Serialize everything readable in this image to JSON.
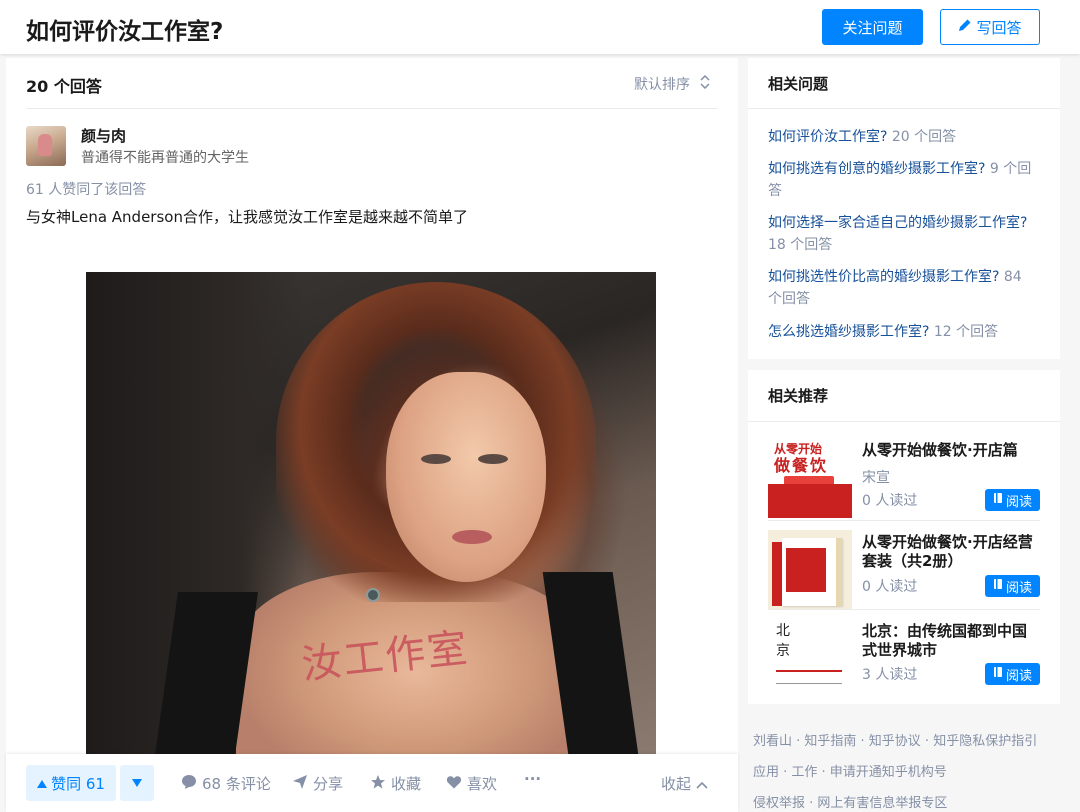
{
  "header": {
    "question_title": "如何评价汝工作室?",
    "follow_label": "关注问题",
    "write_label": "写回答"
  },
  "answers": {
    "count_label": "20 个回答",
    "sort_label": "默认排序"
  },
  "answer": {
    "author_name": "颜与肉",
    "author_bio": "普通得不能再普通的大学生",
    "upvote_text": "61 人赞同了该回答",
    "content": "与女神Lena Anderson合作，让我感觉汝工作室是越来越不简单了",
    "image_text": "汝工作室"
  },
  "actions": {
    "upvote_label": "赞同 61",
    "comments_label": "68 条评论",
    "share_label": "分享",
    "collect_label": "收藏",
    "like_label": "喜欢",
    "more_label": "···",
    "collapse_label": "收起",
    "accent_color": "#0084ff"
  },
  "related_questions": {
    "title": "相关问题",
    "items": [
      {
        "text": "如何评价汝工作室?",
        "count": "20 个回答"
      },
      {
        "text": "如何挑选有创意的婚纱摄影工作室?",
        "count": "9 个回答"
      },
      {
        "text": "如何选择一家合适自己的婚纱摄影工作室?",
        "count": "18 个回答"
      },
      {
        "text": "如何挑选性价比高的婚纱摄影工作室?",
        "count": "84 个回答"
      },
      {
        "text": "怎么挑选婚纱摄影工作室?",
        "count": "12 个回答"
      }
    ]
  },
  "related_recommend": {
    "title": "相关推荐",
    "read_label": "阅读",
    "books": [
      {
        "title": "从零开始做餐饮·开店篇",
        "author": "宋宣",
        "reads": "0 人读过",
        "cover_top": "从零开始",
        "cover_big": "做餐饮"
      },
      {
        "title": "从零开始做餐饮·开店经营套装（共2册）",
        "author": "",
        "reads": "0 人读过"
      },
      {
        "title": "北京：由传统国都到中国式世界城市",
        "author": "",
        "reads": "3 人读过",
        "cover_chars": [
          "北",
          "京"
        ]
      }
    ]
  },
  "footer": {
    "lines": [
      "刘看山 · 知乎指南 · 知乎协议 · 知乎隐私保护指引",
      "应用 · 工作 · 申请开通知乎机构号",
      "侵权举报 · 网上有害信息举报专区"
    ]
  }
}
